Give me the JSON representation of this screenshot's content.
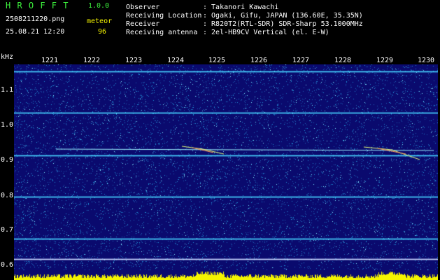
{
  "app": {
    "name": "H R O F F T",
    "version": "1.0.0"
  },
  "file": {
    "name": "2508211220.png",
    "datetime": "25.08.21 12:20"
  },
  "detector": {
    "label": "meteor",
    "count": "96"
  },
  "info": [
    {
      "key": "Observer",
      "value": ": Takanori Kawachi"
    },
    {
      "key": "Receiving Location",
      "value": ": Ogaki, Gifu, JAPAN (136.60E, 35.35N)"
    },
    {
      "key": "Receiver",
      "value": ": R820T2(RTL-SDR) SDR-Sharp 53.1000MHz"
    },
    {
      "key": "Receiving antenna",
      "value": ": 2el-HB9CV Vertical (el. E-W)"
    }
  ],
  "axis": {
    "y_unit": "kHz",
    "y_ticks": [
      "1.1",
      "1.0",
      "0.9",
      "0.8",
      "0.7",
      "0.6"
    ],
    "x_ticks": [
      "1221",
      "1222",
      "1223",
      "1224",
      "1225",
      "1226",
      "1227",
      "1228",
      "1229",
      "1230"
    ]
  },
  "colors": {
    "background": "#0a0a6e",
    "noise": "#1e8fd4",
    "line": "#46d2ff",
    "header_green": "#3cf03c",
    "header_yellow": "#f4f400",
    "power_bar": "#f4f400"
  }
}
